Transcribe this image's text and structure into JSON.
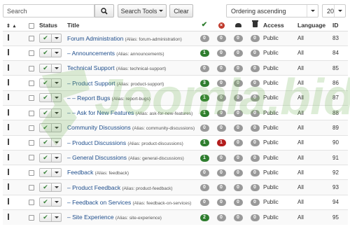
{
  "toolbar": {
    "search_placeholder": "Search",
    "search_tools_label": "Search Tools",
    "clear_label": "Clear",
    "ordering_value": "Ordering ascending",
    "limit_value": "20"
  },
  "table": {
    "headers": {
      "status": "Status",
      "title": "Title",
      "access": "Access",
      "language": "Language",
      "id": "ID"
    },
    "rows": [
      {
        "title": "Forum Administration",
        "alias": "(Alias: forum-administration)",
        "published": "0",
        "unpublished": "0",
        "archived": "0",
        "trashed": "0",
        "access": "Public",
        "language": "All",
        "id": "83"
      },
      {
        "title": "– Announcements",
        "alias": "(Alias: announcements)",
        "published": "1",
        "unpublished": "0",
        "archived": "0",
        "trashed": "0",
        "access": "Public",
        "language": "All",
        "id": "84"
      },
      {
        "title": "Technical Support",
        "alias": "(Alias: technical-support)",
        "published": "0",
        "unpublished": "0",
        "archived": "0",
        "trashed": "0",
        "access": "Public",
        "language": "All",
        "id": "85"
      },
      {
        "title": "– Product Support",
        "alias": "(Alias: product-support)",
        "published": "3",
        "unpublished": "0",
        "archived": "0",
        "trashed": "0",
        "access": "Public",
        "language": "All",
        "id": "86"
      },
      {
        "title": "– – Report Bugs",
        "alias": "(Alias: report-bugs)",
        "published": "1",
        "unpublished": "0",
        "archived": "0",
        "trashed": "0",
        "access": "Public",
        "language": "All",
        "id": "87"
      },
      {
        "title": "– – Ask for New Features",
        "alias": "(Alias: ask-for-new-features)",
        "published": "1",
        "unpublished": "0",
        "archived": "0",
        "trashed": "0",
        "access": "Public",
        "language": "All",
        "id": "88"
      },
      {
        "title": "Community Discussions",
        "alias": "(Alias: community-discussions)",
        "published": "0",
        "unpublished": "0",
        "archived": "0",
        "trashed": "0",
        "access": "Public",
        "language": "All",
        "id": "89"
      },
      {
        "title": "– Product Discussions",
        "alias": "(Alias: product-discussions)",
        "published": "1",
        "unpublished": "1",
        "archived": "0",
        "trashed": "0",
        "access": "Public",
        "language": "All",
        "id": "90"
      },
      {
        "title": "– General Discussions",
        "alias": "(Alias: general-discussions)",
        "published": "1",
        "unpublished": "0",
        "archived": "0",
        "trashed": "0",
        "access": "Public",
        "language": "All",
        "id": "91"
      },
      {
        "title": "Feedback",
        "alias": "(Alias: feedback)",
        "published": "0",
        "unpublished": "0",
        "archived": "0",
        "trashed": "0",
        "access": "Public",
        "language": "All",
        "id": "92"
      },
      {
        "title": "– Product Feedback",
        "alias": "(Alias: product-feedback)",
        "published": "0",
        "unpublished": "0",
        "archived": "0",
        "trashed": "0",
        "access": "Public",
        "language": "All",
        "id": "93"
      },
      {
        "title": "– Feedback on Services",
        "alias": "(Alias: feedback-on-services)",
        "published": "0",
        "unpublished": "0",
        "archived": "0",
        "trashed": "0",
        "access": "Public",
        "language": "All",
        "id": "94"
      },
      {
        "title": "– Site Experience",
        "alias": "(Alias: site-experience)",
        "published": "2",
        "unpublished": "0",
        "archived": "0",
        "trashed": "0",
        "access": "Public",
        "language": "All",
        "id": "95"
      }
    ]
  },
  "watermark": {
    "text": "Joomla.bid"
  },
  "colors": {
    "published_badge": "#2e7d2e",
    "unpublished_badge": "#b31d1d",
    "zero_badge": "#999999",
    "title_link": "#1f4e8c"
  },
  "icons": [
    "search-icon",
    "caret-down-icon",
    "drag-handle-icon",
    "sort-icon",
    "check-icon",
    "x-circle-icon",
    "archive-icon",
    "trash-icon"
  ]
}
